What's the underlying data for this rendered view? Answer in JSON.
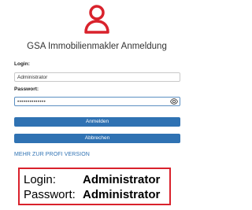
{
  "header": {
    "icon": "user-icon",
    "title": "GSA Immobilienmakler Anmeldung"
  },
  "form": {
    "login_label": "Login:",
    "login_value": "Administrator",
    "password_label": "Passwort:",
    "password_value": "••••••••••••••",
    "password_toggle_icon": "eye-icon"
  },
  "buttons": {
    "login_label": "Anmelden",
    "cancel_label": "Abbrechen"
  },
  "links": {
    "profi_version": "MEHR ZUR PROFI VERSION"
  },
  "credentials_box": {
    "login_key": "Login:",
    "login_value": "Administrator",
    "password_key": "Passwort:",
    "password_value": "Administrator"
  },
  "colors": {
    "accent": "#2f72b3",
    "icon_red": "#d9222c",
    "box_border": "#d9222c"
  }
}
